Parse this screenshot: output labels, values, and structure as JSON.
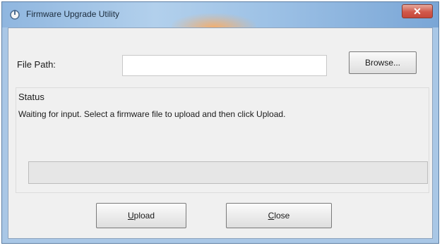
{
  "window": {
    "title": "Firmware Upgrade Utility",
    "close_glyph": "✕"
  },
  "form": {
    "file_label": "File Path:",
    "path_value": "",
    "browse_label": "Browse..."
  },
  "status": {
    "heading": "Status",
    "message": "Waiting for input. Select a firmware file to upload and then click Upload."
  },
  "progress": {
    "fraction": 0
  },
  "buttons": {
    "upload_label": "Upload",
    "close_label": "Close"
  },
  "colors": {
    "frame": "#a9c7e6",
    "client_bg": "#f0f0f0",
    "close_button": "#c6483a",
    "progress_fill": "#06b025"
  },
  "icons": {
    "app": "app-icon",
    "close": "close-icon"
  }
}
